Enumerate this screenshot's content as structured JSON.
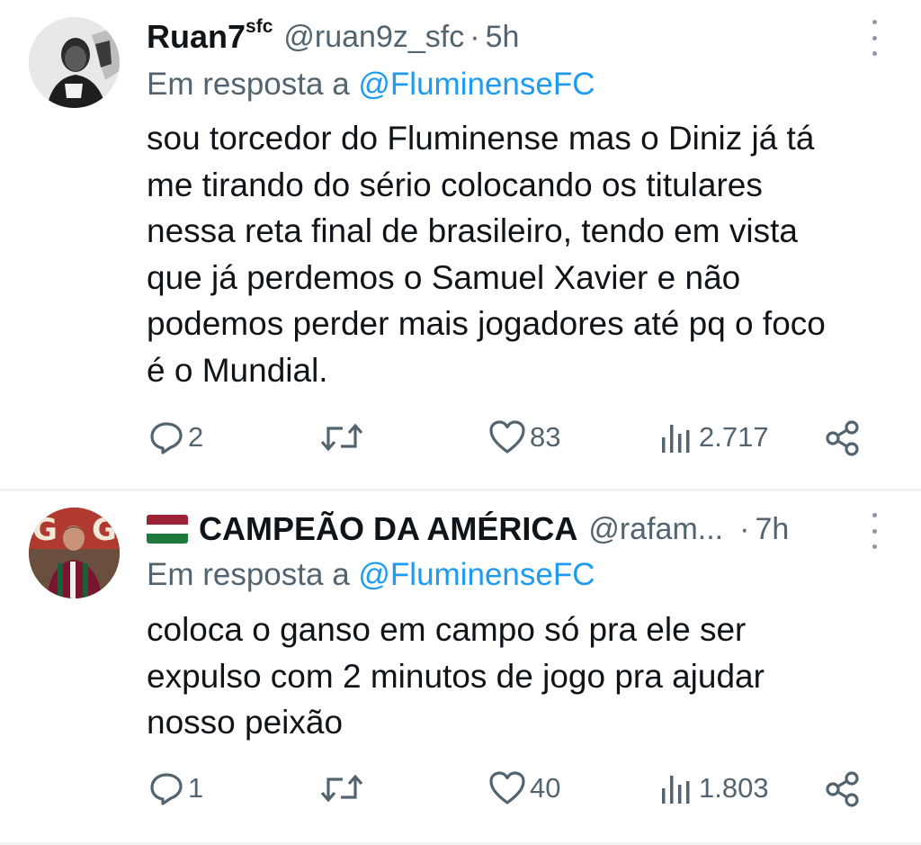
{
  "tweets": [
    {
      "display_name": "Ruan7",
      "display_name_sup": "sfc",
      "handle": "@ruan9z_sfc",
      "separator": "·",
      "time": "5h",
      "reply_prefix": "Em resposta a",
      "reply_to": "@FluminenseFC",
      "text_lines": [
        "sou torcedor do Fluminense mas o Diniz já tá",
        "me tirando do sério colocando os titulares",
        "nessa reta final de brasileiro, tendo em vista",
        "que já perdemos o Samuel Xavier e não",
        "podemos perder mais jogadores até pq o foco",
        "é o Mundial."
      ],
      "replies": "2",
      "likes": "83",
      "views": "2.717"
    },
    {
      "display_name": "CAMPEÃO DA AMÉRICA",
      "handle": "@rafam...",
      "separator": "·",
      "time": "7h",
      "reply_prefix": "Em resposta a",
      "reply_to": "@FluminenseFC",
      "text_lines": [
        "coloca o ganso em campo só pra ele ser",
        "expulso com 2 minutos de jogo pra ajudar",
        "nosso peixão"
      ],
      "replies": "1",
      "likes": "40",
      "views": "1.803"
    }
  ],
  "colors": {
    "text": "#0f1419",
    "secondary": "#536471",
    "link": "#1d9bf0",
    "divider": "#eff3f4"
  },
  "icons": [
    "reply-icon",
    "retweet-icon",
    "like-icon",
    "views-icon",
    "share-icon",
    "more-icon",
    "flag-icon"
  ]
}
